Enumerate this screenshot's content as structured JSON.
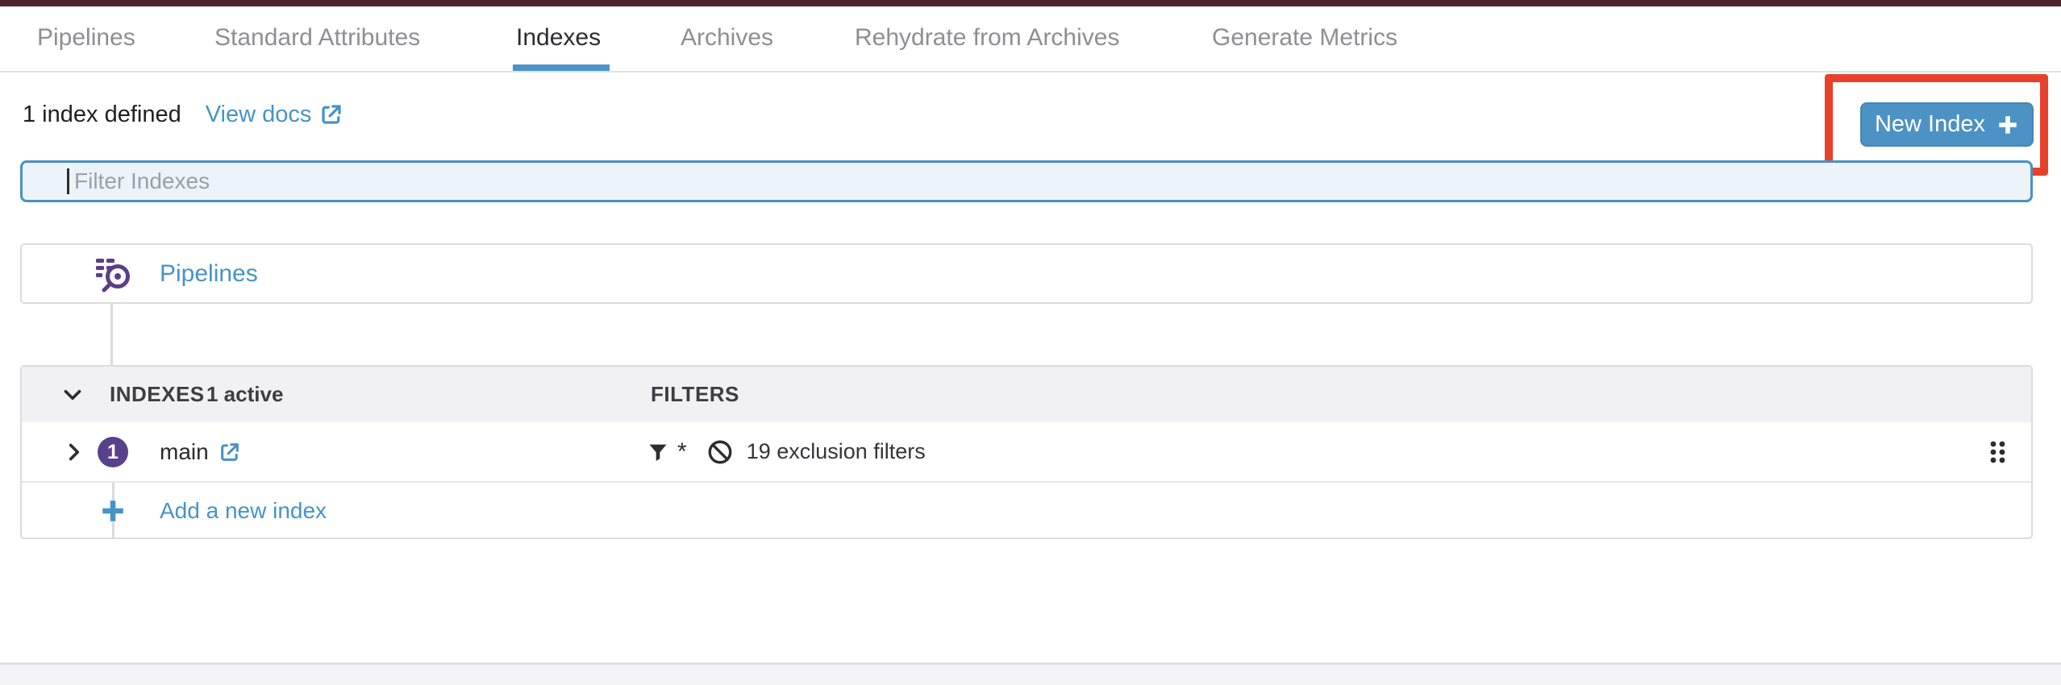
{
  "tabs": [
    {
      "label": "Pipelines",
      "active": false
    },
    {
      "label": "Standard Attributes",
      "active": false
    },
    {
      "label": "Indexes",
      "active": true
    },
    {
      "label": "Archives",
      "active": false
    },
    {
      "label": "Rehydrate from Archives",
      "active": false
    },
    {
      "label": "Generate Metrics",
      "active": false
    }
  ],
  "summary": {
    "count_text": "1 index defined",
    "docs_link_label": "View docs"
  },
  "toolbar": {
    "new_index_label": "New Index"
  },
  "filter": {
    "placeholder": "Filter Indexes",
    "value": ""
  },
  "pipelines_row": {
    "label": "Pipelines"
  },
  "indexes_table": {
    "header": {
      "title": "INDEXES",
      "active_count": "1 active",
      "filters_column": "FILTERS"
    },
    "rows": [
      {
        "order": "1",
        "name": "main",
        "filter_query": "*",
        "exclusions": "19 exclusion filters"
      }
    ],
    "add_row_label": "Add a new index"
  },
  "colors": {
    "accent_blue": "#4693c8",
    "button_blue": "#4c92c4",
    "badge_purple": "#57408c",
    "icon_purple": "#5e3d87",
    "annotation_red": "#e8402b",
    "topbar_maroon": "#4e252b"
  }
}
